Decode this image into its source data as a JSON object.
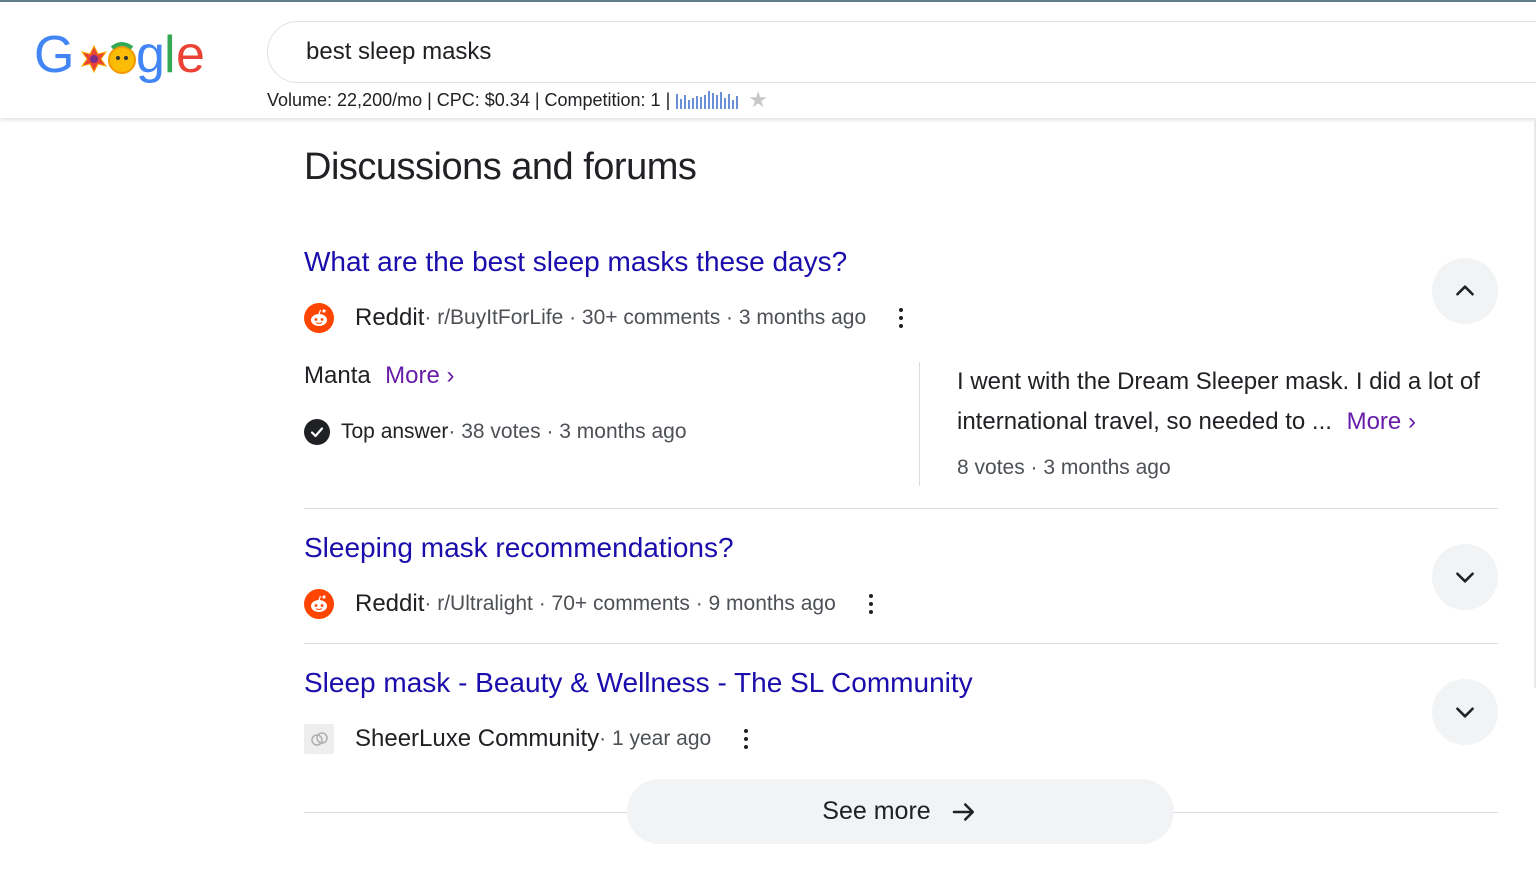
{
  "search": {
    "query": "best sleep masks",
    "keyword_stats": "Volume: 22,200/mo | CPC: $0.34 | Competition: 1 |",
    "trend": [
      0.85,
      0.55,
      0.75,
      0.5,
      0.6,
      0.7,
      0.65,
      0.8,
      1.0,
      0.9,
      0.75,
      0.95,
      0.6,
      0.85,
      0.5,
      0.7
    ]
  },
  "section": {
    "title": "Discussions and forums"
  },
  "results": [
    {
      "title": "What are the best sleep masks these days?",
      "source": "Reddit",
      "meta": " · r/BuyItForLife · 30+ comments · 3 months ago",
      "expanded": true,
      "answers": {
        "left_text": "Manta",
        "left_more": "More",
        "top_answer_label": "Top answer",
        "top_answer_meta": " · 38 votes · 3 months ago",
        "right_text": "I went with the Dream Sleeper mask. I did a lot of international travel, so needed to ...",
        "right_more": "More",
        "right_meta": "8 votes · 3 months ago"
      }
    },
    {
      "title": "Sleeping mask recommendations?",
      "source": "Reddit",
      "meta": " · r/Ultralight · 70+ comments · 9 months ago",
      "expanded": false
    },
    {
      "title": "Sleep mask - Beauty & Wellness - The SL Community",
      "source": "SheerLuxe Community",
      "meta": " · 1 year ago",
      "expanded": false
    }
  ],
  "see_more": {
    "label": "See more"
  },
  "colors": {
    "link": "#1a0dab",
    "visited_more": "#681da8",
    "reddit": "#ff4500"
  }
}
